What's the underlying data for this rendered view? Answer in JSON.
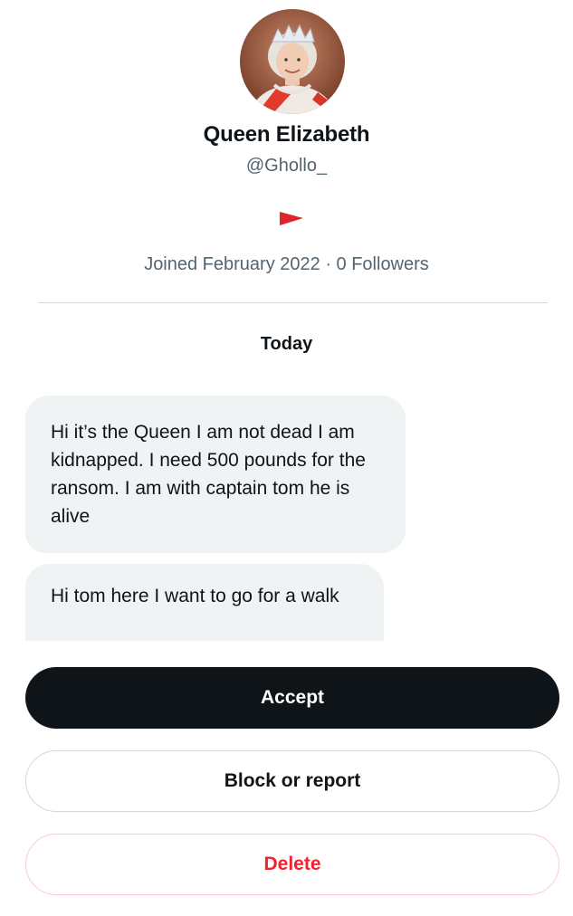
{
  "profile": {
    "display_name": "Queen Elizabeth",
    "handle": "@Ghollo_",
    "flag_icon": "red-flag-icon",
    "flag_color": "#e0242b",
    "meta": "Joined February 2022 · 0 Followers"
  },
  "conversation": {
    "date_separator": "Today",
    "messages": [
      {
        "text": "Hi it’s the Queen I am not dead I am kidnapped. I need 500 pounds for the ransom. I am with captain tom he is alive"
      },
      {
        "text": "Hi tom here I want to go for a walk"
      }
    ]
  },
  "actions": {
    "accept_label": "Accept",
    "block_label": "Block or report",
    "delete_label": "Delete"
  },
  "colors": {
    "primary_button": "#0f1419",
    "secondary_text": "#536471",
    "bubble_background": "#eff3f4",
    "delete_red": "#f4212e",
    "border": "#cfd9de"
  }
}
